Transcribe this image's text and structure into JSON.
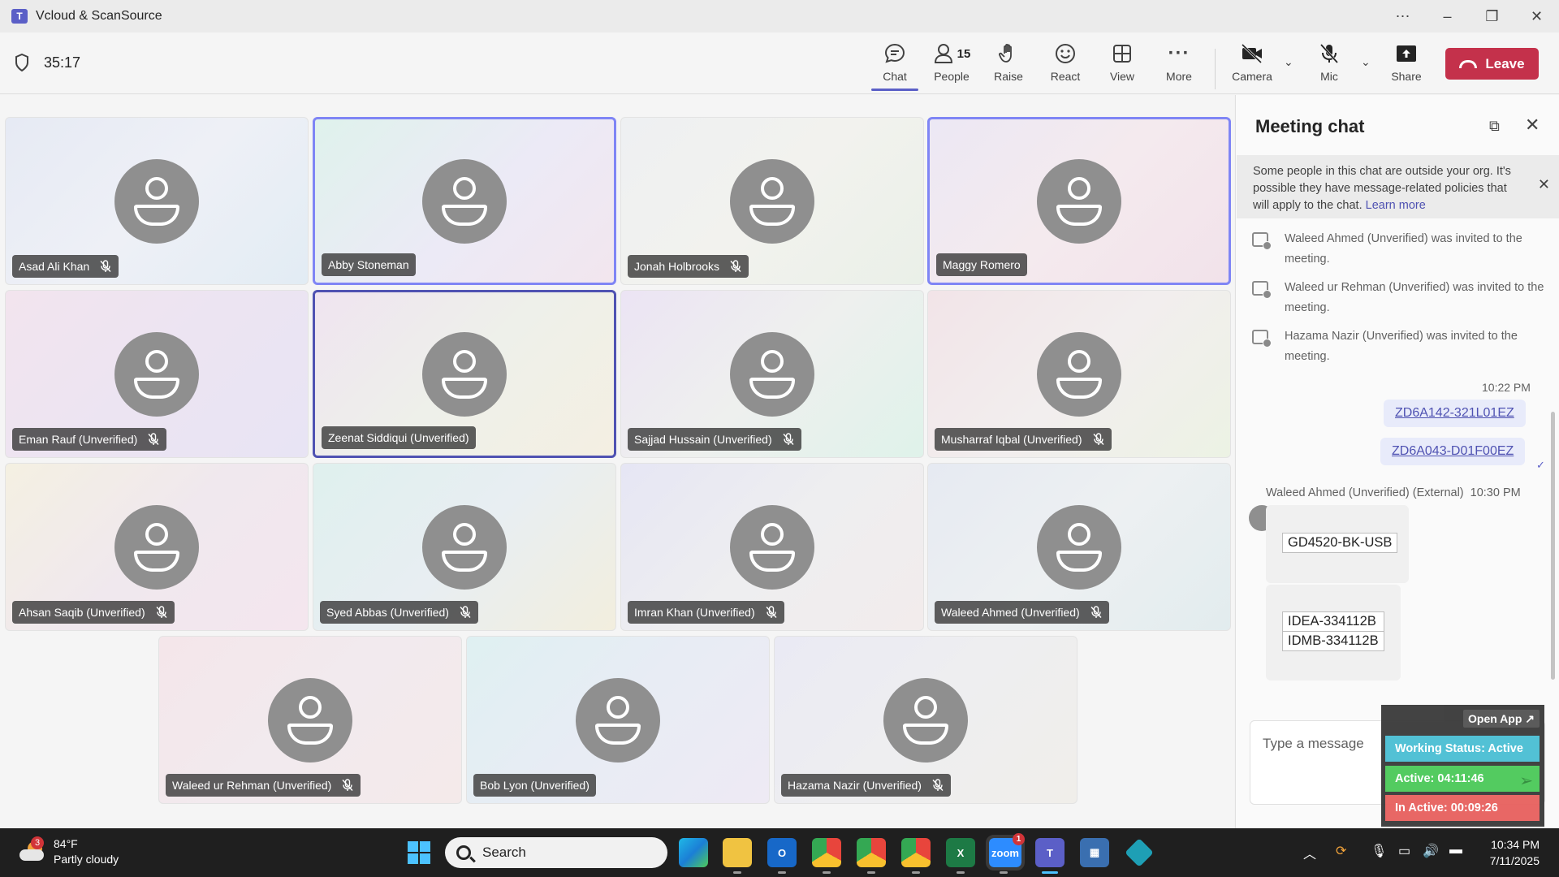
{
  "window": {
    "title": "Vcloud & ScanSource",
    "app_icon": "teams-icon"
  },
  "meeting": {
    "timer": "35:17",
    "toolbar": {
      "chat": "Chat",
      "people": "People",
      "people_count": "15",
      "raise": "Raise",
      "react": "React",
      "view": "View",
      "more": "More",
      "camera": "Camera",
      "mic": "Mic",
      "share": "Share",
      "leave": "Leave"
    }
  },
  "participants": [
    {
      "name": "Asad Ali Khan",
      "muted": true,
      "bg": "linear-gradient(135deg,#e6eaf4,#eef0f6 50%,#e2ecf4)"
    },
    {
      "name": "Abby Stoneman",
      "muted": false,
      "bg": "linear-gradient(135deg,#dff2ec,#eceaf6 55%,#f2e6ee)"
    },
    {
      "name": "Jonah Holbrooks",
      "muted": true,
      "bg": "linear-gradient(135deg,#eef0f2,#f2f2ee 50%,#eaf0e8)"
    },
    {
      "name": "Maggy Romero",
      "muted": false,
      "bg": "linear-gradient(135deg,#ece8f4,#f4eaee 50%,#f2e2ea)"
    },
    {
      "name": "Eman Rauf (Unverified)",
      "muted": true,
      "bg": "linear-gradient(135deg,#f2e4ee,#ece4f2 50%,#e8e4f4)"
    },
    {
      "name": "Zeenat Siddiqui (Unverified)",
      "muted": false,
      "bg": "linear-gradient(135deg,#efe4f0,#eef0ea 50%,#f4efe2)"
    },
    {
      "name": "Sajjad Hussain (Unverified)",
      "muted": true,
      "bg": "linear-gradient(135deg,#ece4f4,#eef0ee 50%,#dff2ea)"
    },
    {
      "name": "Musharraf Iqbal (Unverified)",
      "muted": true,
      "bg": "linear-gradient(135deg,#f2e4e8,#f2eeee 50%,#ecf2e4)"
    },
    {
      "name": "Ahsan Saqib (Unverified)",
      "muted": true,
      "bg": "linear-gradient(135deg,#f4f0e2,#f0e8ee 50%,#f4e6ee)"
    },
    {
      "name": "Syed Abbas (Unverified)",
      "muted": true,
      "bg": "linear-gradient(135deg,#dff0ee,#e8eef2 50%,#f2eede)"
    },
    {
      "name": "Imran Khan (Unverified)",
      "muted": true,
      "bg": "linear-gradient(135deg,#e6e6f4,#eeeef0 50%,#f2ecec)"
    },
    {
      "name": "Waleed Ahmed (Unverified)",
      "muted": true,
      "bg": "linear-gradient(135deg,#e6eaf2,#edf0f2 50%,#e2ecee)"
    },
    {
      "name": "Waleed ur Rehman (Unverified)",
      "muted": true,
      "bg": "linear-gradient(135deg,#f4e6ea,#f2eaee 50%,#f4eaea)"
    },
    {
      "name": "Bob Lyon (Unverified)",
      "muted": false,
      "bg": "linear-gradient(135deg,#dff0f2,#e8ecf4 50%,#eeeaf4)"
    },
    {
      "name": "Hazama Nazir (Unverified)",
      "muted": true,
      "bg": "linear-gradient(135deg,#eaeaf4,#eeeef0 50%,#f0eeea)"
    }
  ],
  "chat": {
    "title": "Meeting chat",
    "notice": "Some people in this chat are outside your org. It's possible they have message-related policies that will apply to the chat.",
    "notice_link": "Learn more",
    "system_messages": [
      "Waleed Ahmed (Unverified) was invited to the meeting.",
      "Waleed ur Rehman (Unverified) was invited to the meeting.",
      "Hazama Nazir (Unverified) was invited to the meeting."
    ],
    "my_time": "10:22 PM",
    "my_messages": [
      "ZD6A142-321L01EZ",
      "ZD6A043-D01F00EZ"
    ],
    "sender": "Waleed Ahmed (Unverified) (External)",
    "sender_time": "10:30 PM",
    "their_messages": [
      "GD4520-BK-USB",
      "IDEA-334112B",
      "IDMB-334112B"
    ],
    "compose_placeholder": "Type a message"
  },
  "widget": {
    "open_app": "Open App ↗",
    "working_status": "Working Status: Active",
    "active": "Active: 04:11:46",
    "inactive": "In Active: 00:09:26",
    "colors": {
      "status": "#4bbfd4",
      "active": "#4dc95a",
      "inactive": "#e8625f"
    }
  },
  "taskbar": {
    "weather_temp": "84°F",
    "weather_desc": "Partly cloudy",
    "weather_badge": "3",
    "search": "Search",
    "time": "10:34 PM",
    "date": "7/11/2025",
    "zoom_badge": "1"
  },
  "colors": {
    "accent": "#5b5fc7",
    "leave": "#c4314b"
  }
}
